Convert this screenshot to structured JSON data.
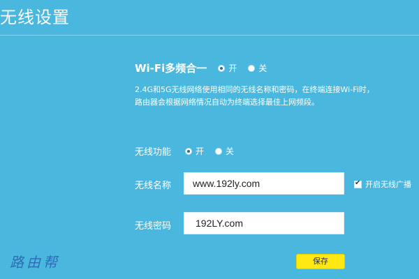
{
  "header": {
    "title": "无线设置"
  },
  "multiband": {
    "label": "Wi-Fi多频合一",
    "option_on": "开",
    "option_off": "关",
    "selected": "on",
    "description_line1": "2.4G和5G无线网络使用相同的无线名称和密码，在终端连接Wi-Fi时，",
    "description_line2": "路由器会根据网络情况自动为终端选择最佳上网频段。"
  },
  "wireless": {
    "label": "无线功能",
    "option_on": "开",
    "option_off": "关",
    "selected": "on"
  },
  "ssid": {
    "label": "无线名称",
    "value": "www.192ly.com",
    "broadcast_label": "开启无线广播",
    "broadcast_checked": true
  },
  "password": {
    "label": "无线密码",
    "value": "192LY.com"
  },
  "actions": {
    "save_label": "保存"
  },
  "watermark": {
    "text": "路由帮"
  },
  "colors": {
    "background": "#4ab8de",
    "save_button": "#ffe814"
  }
}
